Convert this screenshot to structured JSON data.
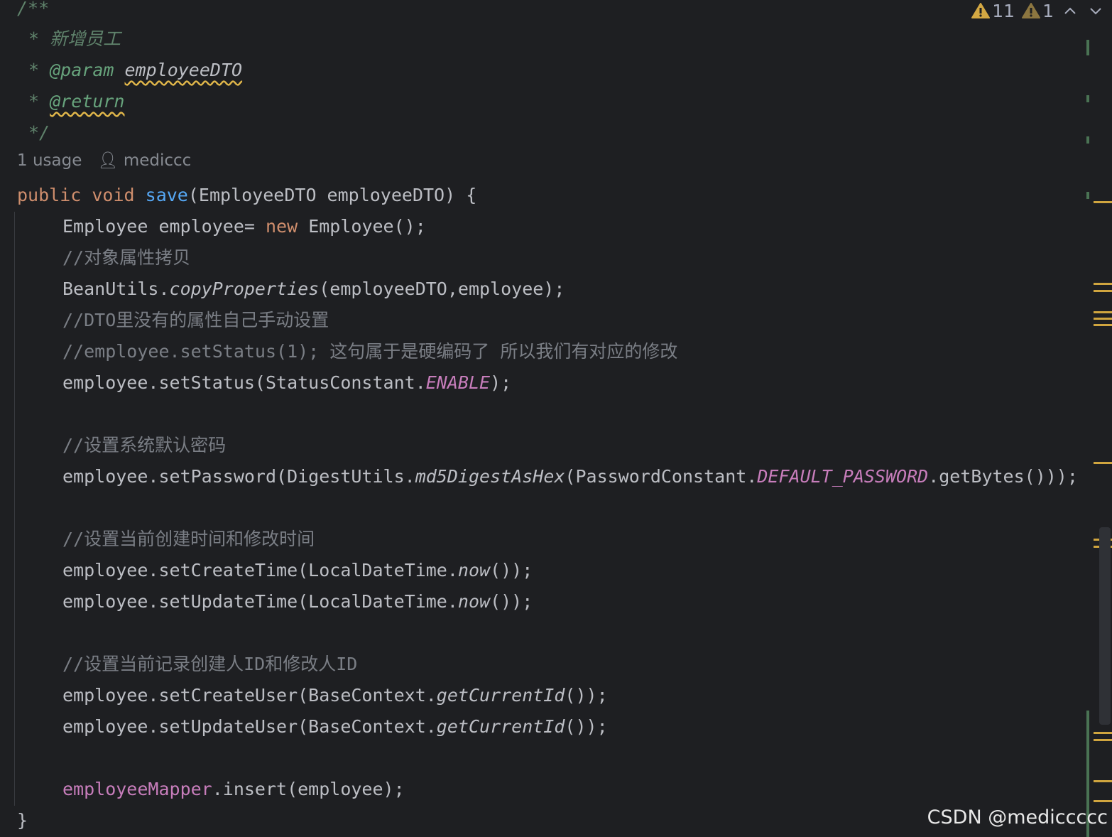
{
  "status": {
    "warnings_count": "11",
    "weak_warnings_count": "1"
  },
  "doc": {
    "open": "/**",
    "star": "*",
    "desc": "新增员工",
    "param_tag": "@param",
    "param_name": "employeeDTO",
    "return_tag": "@return",
    "close": "*/"
  },
  "hints": {
    "usages": "1 usage",
    "author": "mediccc"
  },
  "code": {
    "sig_kw1": "public",
    "sig_kw2": "void",
    "sig_name": "save",
    "sig_rest": "(EmployeeDTO employeeDTO) {",
    "l1a": "Employee employee= ",
    "l1kw": "new",
    "l1b": " Employee();",
    "c1": "//对象属性拷贝",
    "l2a": "BeanUtils.",
    "l2m": "copyProperties",
    "l2b": "(employeeDTO,employee);",
    "c2": "//DTO里没有的属性自己手动设置",
    "c3": "//employee.setStatus(1); 这句属于是硬编码了 所以我们有对应的修改",
    "l3a": "employee.setStatus(StatusConstant.",
    "l3s": "ENABLE",
    "l3b": ");",
    "c4": "//设置系统默认密码",
    "l4a": "employee.setPassword(DigestUtils.",
    "l4m": "md5DigestAsHex",
    "l4b": "(PasswordConstant.",
    "l4s": "DEFAULT_PASSWORD",
    "l4c": ".getBytes()));",
    "c5": "//设置当前创建时间和修改时间",
    "l5a": "employee.setCreateTime(LocalDateTime.",
    "l5m": "now",
    "l5b": "());",
    "l6a": "employee.setUpdateTime(LocalDateTime.",
    "l6m": "now",
    "l6b": "());",
    "c6": "//设置当前记录创建人ID和修改人ID",
    "l7a": "employee.setCreateUser(BaseContext.",
    "l7m": "getCurrentId",
    "l7b": "());",
    "l8a": "employee.setUpdateUser(BaseContext.",
    "l8m": "getCurrentId",
    "l8b": "());",
    "l9f": "employeeMapper",
    "l9b": ".insert(employee);",
    "close": "}"
  },
  "watermark": "CSDN @mediccccc",
  "colors": {
    "background": "#1e1f22",
    "keyword": "#cf8e6d",
    "function": "#56a8f5",
    "comment": "#7a7e85",
    "doc": "#5f826b",
    "static": "#c77dbb"
  }
}
